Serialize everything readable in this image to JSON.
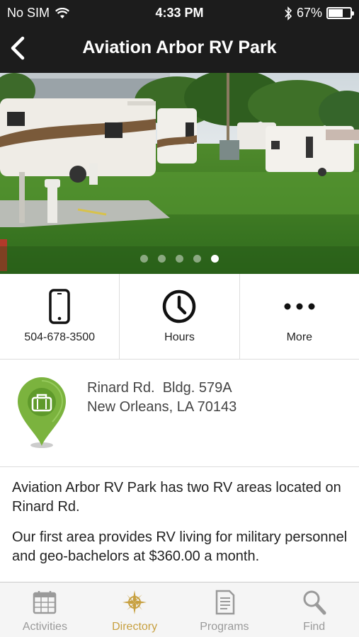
{
  "status_bar": {
    "carrier": "No SIM",
    "time": "4:33 PM",
    "battery_text": "67%",
    "battery_level": 0.67
  },
  "nav": {
    "title": "Aviation Arbor RV Park",
    "back_icon": "chevron-left-icon"
  },
  "gallery": {
    "page_count": 5,
    "current_page": 5
  },
  "actions": [
    {
      "label": "504-678-3500",
      "icon": "phone-icon"
    },
    {
      "label": "Hours",
      "icon": "clock-icon"
    },
    {
      "label": "More",
      "icon": "more-dots-icon"
    }
  ],
  "address": {
    "line1": "Rinard Rd.  Bldg. 579A",
    "line2": "New Orleans, LA 70143",
    "icon": "map-pin-briefcase-icon"
  },
  "description": {
    "p1": "Aviation Arbor RV Park has two RV areas located on Rinard Rd.",
    "p2": "Our first area provides RV living for military personnel and geo-bachelors at $360.00 a month."
  },
  "tabs": [
    {
      "label": "Activities",
      "icon": "calendar-icon",
      "active": false
    },
    {
      "label": "Directory",
      "icon": "compass-icon",
      "active": true
    },
    {
      "label": "Programs",
      "icon": "document-icon",
      "active": false
    },
    {
      "label": "Find",
      "icon": "search-icon",
      "active": false
    }
  ],
  "colors": {
    "nav_background": "#1c1c1c",
    "active_tab": "#c7a040",
    "inactive_tab": "#9a9a9a",
    "pin_green": "#7bb33e"
  }
}
